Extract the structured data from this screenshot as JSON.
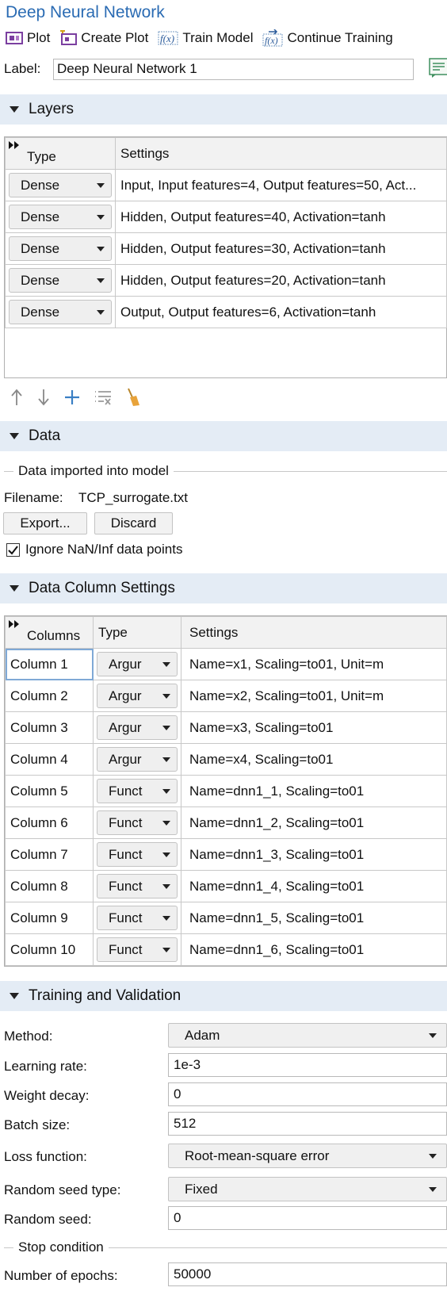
{
  "window": {
    "title": "Deep Neural Network"
  },
  "toolbar": {
    "plot": "Plot",
    "create_plot": "Create Plot",
    "train_model": "Train Model",
    "continue_training": "Continue Training"
  },
  "label_row": {
    "label": "Label:",
    "value": "Deep Neural Network 1"
  },
  "layers": {
    "section_title": "Layers",
    "headers": {
      "type": "Type",
      "settings": "Settings"
    },
    "rows": [
      {
        "type": "Dense",
        "settings": "Input, Input features=4, Output features=50, Act..."
      },
      {
        "type": "Dense",
        "settings": "Hidden, Output features=40, Activation=tanh"
      },
      {
        "type": "Dense",
        "settings": "Hidden, Output features=30, Activation=tanh"
      },
      {
        "type": "Dense",
        "settings": "Hidden, Output features=20, Activation=tanh"
      },
      {
        "type": "Dense",
        "settings": "Output, Output features=6, Activation=tanh"
      }
    ]
  },
  "data": {
    "section_title": "Data",
    "group_title": "Data imported into model",
    "filename_label": "Filename:",
    "filename": "TCP_surrogate.txt",
    "export": "Export...",
    "discard": "Discard",
    "ignore_nan": "Ignore NaN/Inf data points",
    "ignore_nan_checked": true
  },
  "columns": {
    "section_title": "Data Column Settings",
    "headers": {
      "columns": "Columns",
      "type": "Type",
      "settings": "Settings"
    },
    "rows": [
      {
        "column": "Column 1",
        "type": "Argur",
        "settings": "Name=x1, Scaling=to01, Unit=m"
      },
      {
        "column": "Column 2",
        "type": "Argur",
        "settings": "Name=x2, Scaling=to01, Unit=m"
      },
      {
        "column": "Column 3",
        "type": "Argur",
        "settings": "Name=x3, Scaling=to01"
      },
      {
        "column": "Column 4",
        "type": "Argur",
        "settings": "Name=x4, Scaling=to01"
      },
      {
        "column": "Column 5",
        "type": "Funct",
        "settings": "Name=dnn1_1, Scaling=to01"
      },
      {
        "column": "Column 6",
        "type": "Funct",
        "settings": "Name=dnn1_2, Scaling=to01"
      },
      {
        "column": "Column 7",
        "type": "Funct",
        "settings": "Name=dnn1_3, Scaling=to01"
      },
      {
        "column": "Column 8",
        "type": "Funct",
        "settings": "Name=dnn1_4, Scaling=to01"
      },
      {
        "column": "Column 9",
        "type": "Funct",
        "settings": "Name=dnn1_5, Scaling=to01"
      },
      {
        "column": "Column 10",
        "type": "Funct",
        "settings": "Name=dnn1_6, Scaling=to01"
      }
    ]
  },
  "training": {
    "section_title": "Training and Validation",
    "method_label": "Method:",
    "method": "Adam",
    "learning_rate_label": "Learning rate:",
    "learning_rate": "1e-3",
    "weight_decay_label": "Weight decay:",
    "weight_decay": "0",
    "batch_size_label": "Batch size:",
    "batch_size": "512",
    "loss_label": "Loss function:",
    "loss": "Root-mean-square error",
    "seed_type_label": "Random seed type:",
    "seed_type": "Fixed",
    "seed_label": "Random seed:",
    "seed": "0",
    "stop_group": "Stop condition",
    "epochs_label": "Number of epochs:",
    "epochs": "50000"
  },
  "colors": {
    "title": "#2a6bb3",
    "section_bg": "#e4ecf5",
    "accent_blue": "#3a7fc4"
  }
}
